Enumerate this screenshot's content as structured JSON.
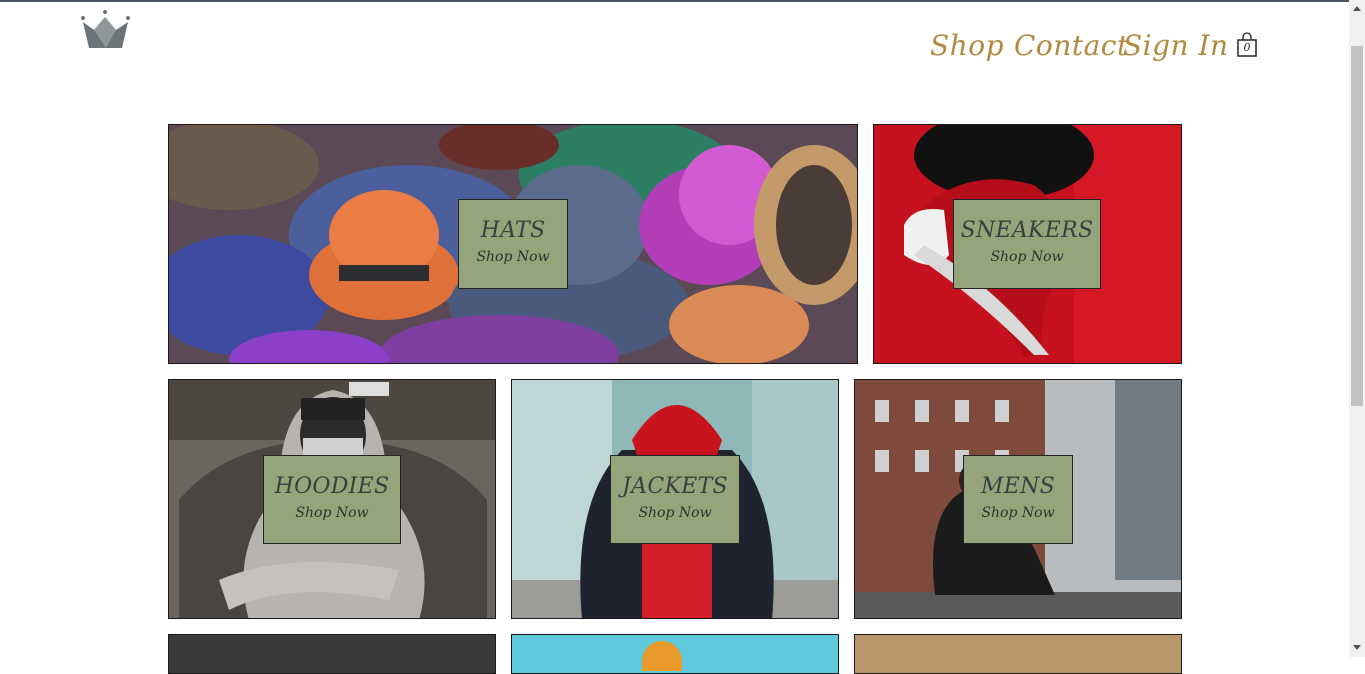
{
  "header": {
    "nav": [
      {
        "label": "Shop"
      },
      {
        "label": "Contact"
      },
      {
        "label": "Sign In"
      }
    ],
    "cart_count": "0"
  },
  "tiles": [
    {
      "title": "HATS",
      "cta": "Shop Now"
    },
    {
      "title": "SNEAKERS",
      "cta": "Shop Now"
    },
    {
      "title": "HOODIES",
      "cta": "Shop Now"
    },
    {
      "title": "JACKETS",
      "cta": "Shop Now"
    },
    {
      "title": "MENS",
      "cta": "Shop Now"
    }
  ],
  "colors": {
    "nav_text": "#b3893e",
    "cta_background": "#94a57c",
    "cta_text": "#3d3d3d"
  }
}
